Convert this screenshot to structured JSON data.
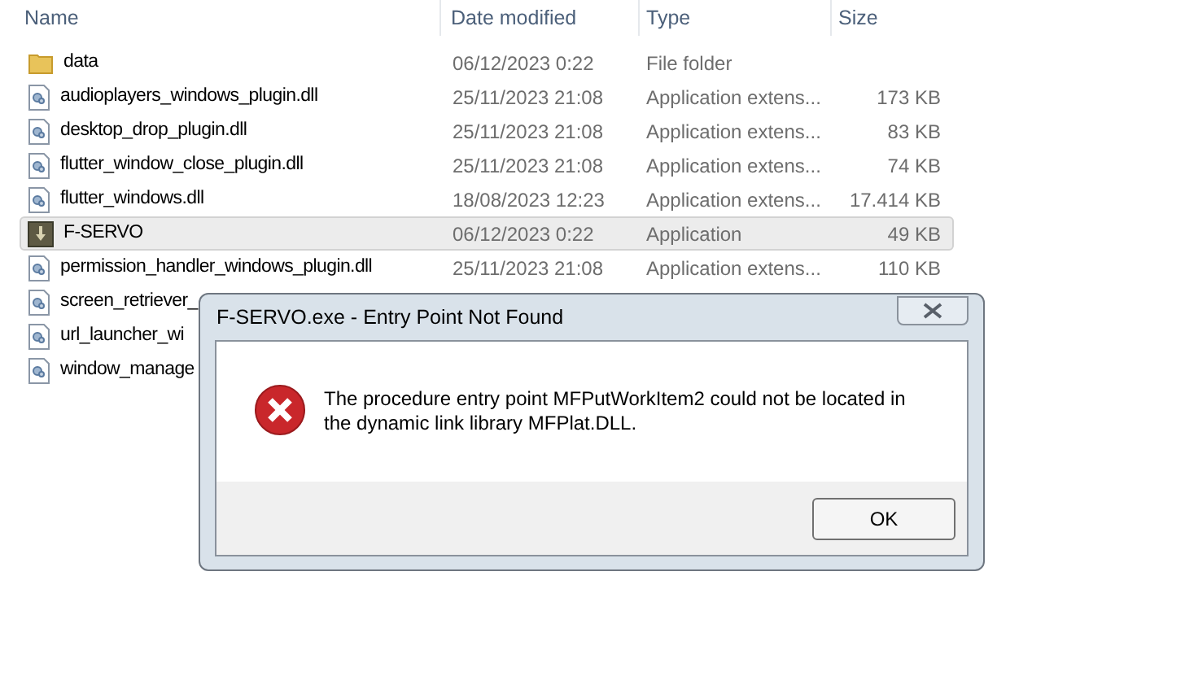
{
  "columns": [
    "Name",
    "Date modified",
    "Type",
    "Size"
  ],
  "files": [
    {
      "kind": "folder",
      "name": "data",
      "date": "06/12/2023 0:22",
      "type": "File folder",
      "selected": false
    },
    {
      "kind": "dll",
      "name": "audioplayers_windows_plugin.dll",
      "date": "25/11/2023 21:08",
      "type": "Application extens...",
      "size": "173 KB",
      "selected": false
    },
    {
      "kind": "dll",
      "name": "desktop_drop_plugin.dll",
      "date": "25/11/2023 21:08",
      "type": "Application extens...",
      "size": "83 KB",
      "selected": false
    },
    {
      "kind": "dll",
      "name": "flutter_window_close_plugin.dll",
      "date": "25/11/2023 21:08",
      "type": "Application extens...",
      "size": "74 KB",
      "selected": false
    },
    {
      "kind": "dll",
      "name": "flutter_windows.dll",
      "date": "18/08/2023 12:23",
      "type": "Application extens...",
      "size": "17.414 KB",
      "selected": false
    },
    {
      "kind": "app",
      "name": "F-SERVO",
      "date": "06/12/2023 0:22",
      "type": "Application",
      "size": "49 KB",
      "selected": true
    },
    {
      "kind": "dll",
      "name": "permission_handler_windows_plugin.dll",
      "date": "25/11/2023 21:08",
      "type": "Application extens...",
      "size": "110 KB",
      "selected": false
    },
    {
      "kind": "dll",
      "name": "screen_retriever_",
      "selected": false
    },
    {
      "kind": "dll",
      "name": "url_launcher_wi",
      "selected": false
    },
    {
      "kind": "dll",
      "name": "window_manage",
      "selected": false
    }
  ],
  "dialog": {
    "title": "F-SERVO.exe - Entry Point Not Found",
    "message": "The procedure entry point MFPutWorkItem2 could not be located in the dynamic link library MFPlat.DLL.",
    "button": "OK"
  }
}
